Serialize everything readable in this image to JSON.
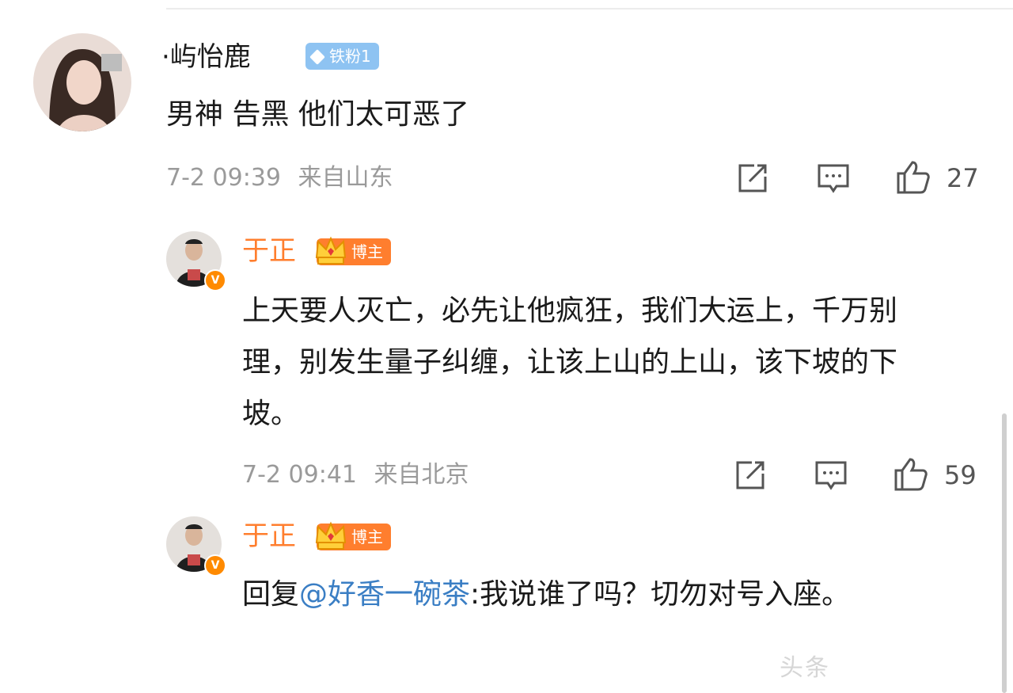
{
  "comments": [
    {
      "username": "·屿怡鹿",
      "badge": "铁粉1",
      "text": "男神 告黑 他们太可恶了",
      "time": "7-2 09:39",
      "location": "来自山东",
      "likes": "27"
    },
    {
      "username": "于正",
      "badge": "博主",
      "text": "上天要人灭亡，必先让他疯狂，我们大运上，千万别理，别发生量子纠缠，让该上山的上山，该下坡的下坡。",
      "time": "7-2 09:41",
      "location": "来自北京",
      "likes": "59"
    },
    {
      "username": "于正",
      "badge": "博主",
      "reply_prefix": "回复",
      "mention": "@好香一碗茶",
      "reply_text": ":我说谁了吗？切勿对号入座。"
    }
  ],
  "watermark": "头条",
  "colors": {
    "host_orange": "#ff7e2e",
    "fan_badge_blue": "#8ec3f2",
    "mention_blue": "#3a7ec4",
    "meta_gray": "#9a9a9a"
  },
  "icons": [
    "share-icon",
    "comment-icon",
    "like-icon",
    "crown-icon",
    "verified-icon",
    "diamond-icon"
  ]
}
